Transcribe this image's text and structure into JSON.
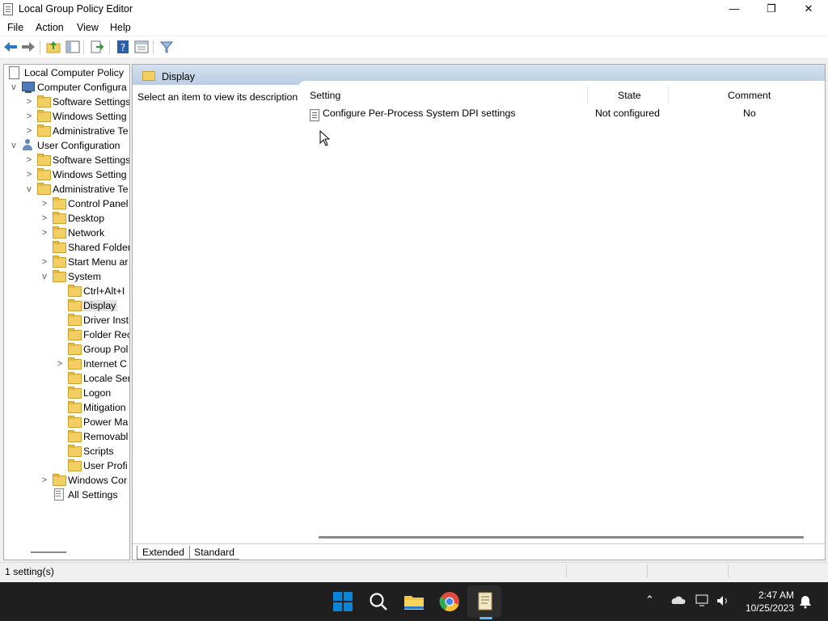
{
  "window": {
    "title": "Local Group Policy Editor",
    "controls": {
      "minimize": "—",
      "restore": "❐",
      "close": "✕"
    }
  },
  "menu": [
    "File",
    "Action",
    "View",
    "Help"
  ],
  "tree": {
    "root": "Local Computer Policy",
    "items": [
      {
        "label": "Computer Configura",
        "expander": "v"
      },
      {
        "label": "Software Settings",
        "expander": ">"
      },
      {
        "label": "Windows Setting",
        "expander": ">"
      },
      {
        "label": "Administrative Te",
        "expander": ">"
      },
      {
        "label": "User Configuration",
        "expander": "v"
      },
      {
        "label": "Software Settings",
        "expander": ">"
      },
      {
        "label": "Windows Setting",
        "expander": ">"
      },
      {
        "label": "Administrative Te",
        "expander": "v"
      },
      {
        "label": "Control Panel",
        "expander": ">"
      },
      {
        "label": "Desktop",
        "expander": ">"
      },
      {
        "label": "Network",
        "expander": ">"
      },
      {
        "label": "Shared Folder",
        "expander": ""
      },
      {
        "label": "Start Menu ar",
        "expander": ">"
      },
      {
        "label": "System",
        "expander": "v"
      },
      {
        "label": "Ctrl+Alt+I",
        "expander": ""
      },
      {
        "label": "Display",
        "expander": "",
        "selected": true
      },
      {
        "label": "Driver Inst",
        "expander": ""
      },
      {
        "label": "Folder Rec",
        "expander": ""
      },
      {
        "label": "Group Pol",
        "expander": ""
      },
      {
        "label": "Internet C",
        "expander": ">"
      },
      {
        "label": "Locale Ser",
        "expander": ""
      },
      {
        "label": "Logon",
        "expander": ""
      },
      {
        "label": "Mitigation",
        "expander": ""
      },
      {
        "label": "Power Ma",
        "expander": ""
      },
      {
        "label": "Removabl",
        "expander": ""
      },
      {
        "label": "Scripts",
        "expander": ""
      },
      {
        "label": "User Profi",
        "expander": ""
      },
      {
        "label": "Windows Cor",
        "expander": ">"
      },
      {
        "label": "All Settings",
        "expander": ""
      }
    ]
  },
  "details": {
    "header_title": "Display",
    "description": "Select an item to view its description.",
    "columns": {
      "setting": "Setting",
      "state": "State",
      "comment": "Comment"
    },
    "rows": [
      {
        "setting": "Configure Per-Process System DPI settings",
        "state": "Not configured",
        "comment": "No"
      }
    ],
    "tabs": {
      "extended": "Extended",
      "standard": "Standard"
    }
  },
  "status": {
    "text": "1 setting(s)"
  },
  "taskbar": {
    "time": "2:47 AM",
    "date": "10/25/2023",
    "apps": [
      "start-icon",
      "search-icon",
      "file-explorer-icon",
      "chrome-icon",
      "group-policy-icon"
    ]
  },
  "colors": {
    "header_band": "#c8d8ea",
    "taskbar": "#1f1f1f",
    "start_blue": "#0a84d6"
  }
}
